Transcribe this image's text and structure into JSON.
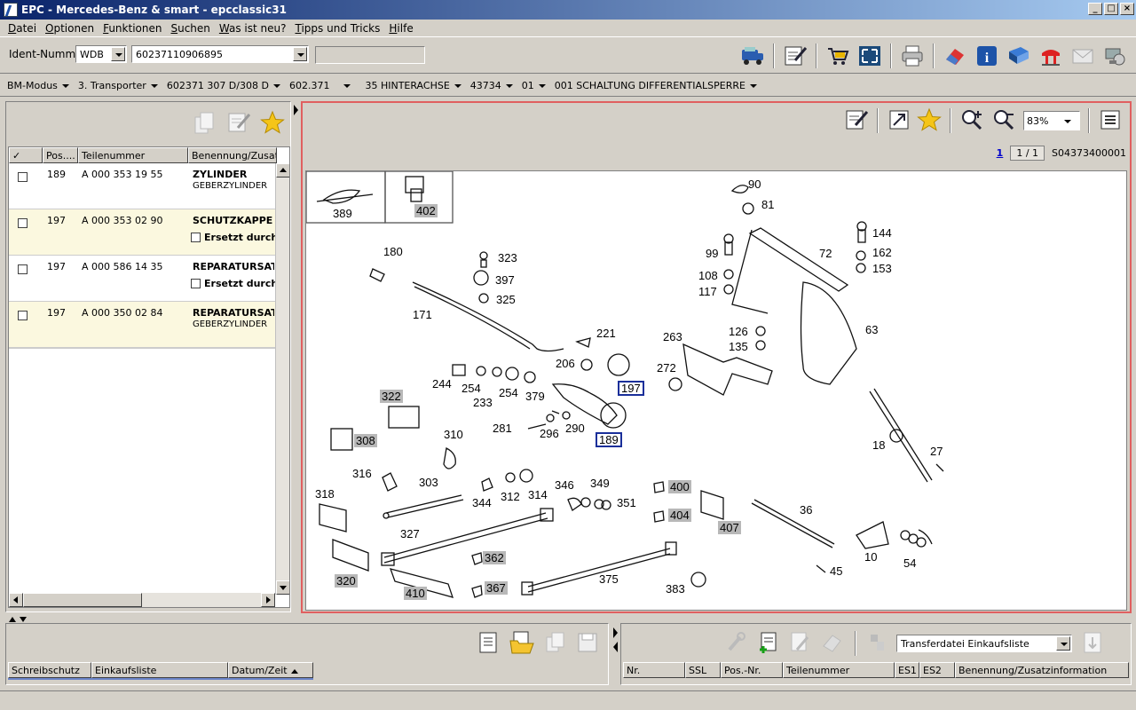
{
  "window": {
    "title": "EPC - Mercedes-Benz & smart - epcclassic31"
  },
  "menu": [
    {
      "u": "D",
      "rest": "atei"
    },
    {
      "u": "O",
      "rest": "ptionen"
    },
    {
      "u": "F",
      "rest": "unktionen"
    },
    {
      "u": "S",
      "rest": "uchen"
    },
    {
      "u": "W",
      "rest": "as ist neu?"
    },
    {
      "u": "T",
      "rest": "ipps und Tricks"
    },
    {
      "u": "H",
      "rest": "ilfe"
    }
  ],
  "ident": {
    "label": "Ident-Nummer",
    "prefix": "WDB",
    "number": "60237110906895"
  },
  "breadcrumbs": [
    "BM-Modus",
    "3. Transporter",
    "602371 307 D/308 D",
    "602.371",
    "35 HINTERACHSE",
    "43734",
    "01",
    "001 SCHALTUNG DIFFERENTIALSPERRE"
  ],
  "parts_table": {
    "headers": [
      "✓",
      "Pos....",
      "Teilenummer",
      "Benennung/Zusatzi"
    ],
    "rows": [
      {
        "pos": "189",
        "part": "A 000 353 19 55",
        "name": "ZYLINDER",
        "sub": "GEBERZYLINDER",
        "replaced": ""
      },
      {
        "pos": "197",
        "part": "A 000 353 02 90",
        "name": "SCHUTZKAPPE",
        "sub": "",
        "replaced": "Ersetzt durch:"
      },
      {
        "pos": "197",
        "part": "A 000 586 14 35",
        "name": "REPARATURSATZ",
        "sub": "",
        "replaced": "Ersetzt durch:"
      },
      {
        "pos": "197",
        "part": "A 000 350 02 84",
        "name": "REPARATURSATZ",
        "sub": "GEBERZYLINDER",
        "replaced": ""
      }
    ]
  },
  "viewer": {
    "zoom": "83%",
    "page_link": "1",
    "page_count": "1 / 1",
    "image_id": "S04373400001"
  },
  "drawing_labels": {
    "l389": "389",
    "l402": "402",
    "l180": "180",
    "l171": "171",
    "l323": "323",
    "l397": "397",
    "l325": "325",
    "l221": "221",
    "l206": "206",
    "l197": "197",
    "l244": "244",
    "l254a": "254",
    "l254b": "254",
    "l233": "233",
    "l379": "379",
    "l322": "322",
    "l308": "308",
    "l310": "310",
    "l281": "281",
    "l296": "296",
    "l290": "290",
    "l189": "189",
    "l316": "316",
    "l303": "303",
    "l344": "344",
    "l312": "312",
    "l314": "314",
    "l346": "346",
    "l349": "349",
    "l351": "351",
    "l318": "318",
    "l327": "327",
    "l320": "320",
    "l410": "410",
    "l362": "362",
    "l367": "367",
    "l375": "375",
    "l383": "383",
    "l400": "400",
    "l404": "404",
    "l407": "407",
    "l36": "36",
    "l10": "10",
    "l54": "54",
    "l45": "45",
    "l18": "18",
    "l27": "27",
    "l90": "90",
    "l81": "81",
    "l99": "99",
    "l108": "108",
    "l117": "117",
    "l72": "72",
    "l144": "144",
    "l162": "162",
    "l153": "153",
    "l63": "63",
    "l263": "263",
    "l272": "272",
    "l126": "126",
    "l135": "135"
  },
  "bottom_left": {
    "headers": [
      "Schreibschutz",
      "Einkaufsliste",
      "Datum/Zeit"
    ]
  },
  "bottom_right": {
    "transfer": "Transferdatei Einkaufsliste",
    "headers": [
      "Nr.",
      "SSL",
      "Pos.-Nr.",
      "Teilenummer",
      "ES1",
      "ES2",
      "Benennung/Zusatzinformation"
    ]
  }
}
